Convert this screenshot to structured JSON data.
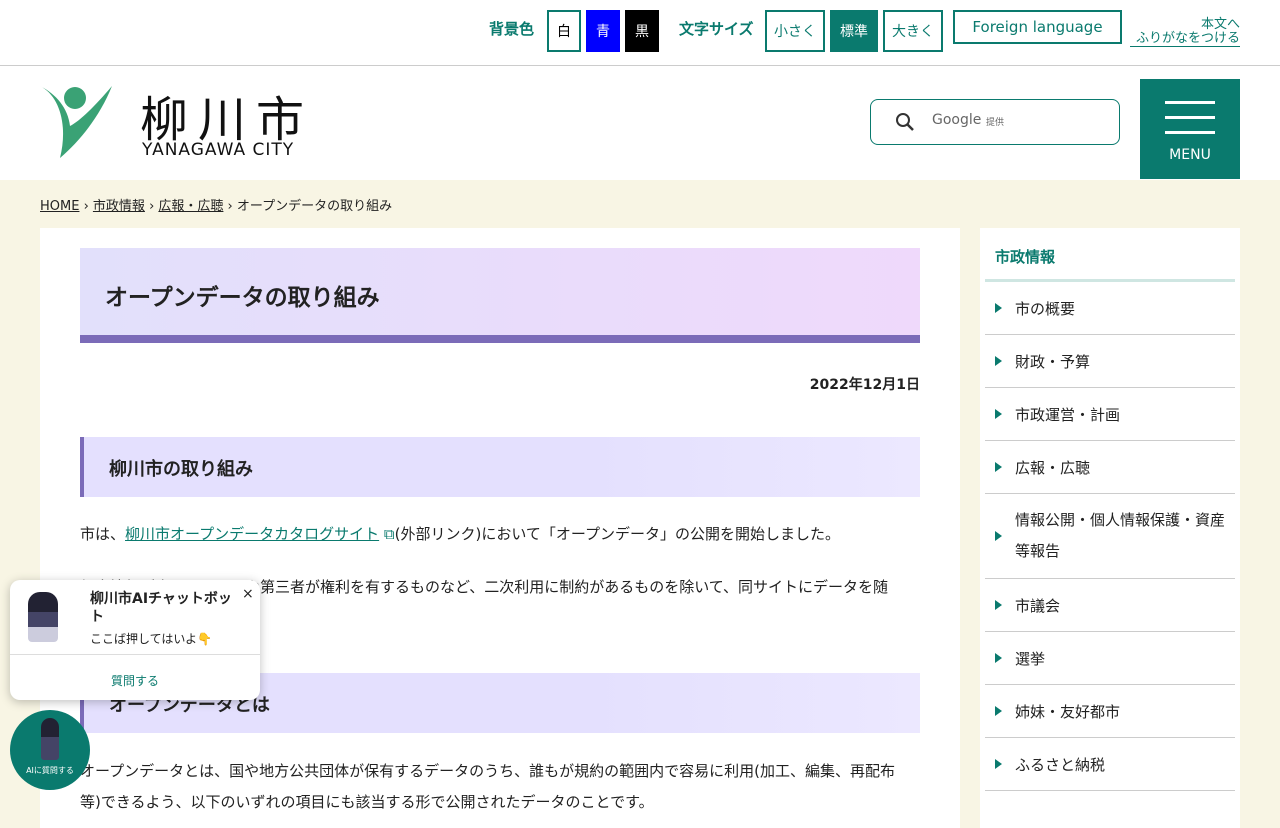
{
  "topbar": {
    "bg_label": "背景色",
    "bg_white": "白",
    "bg_blue": "青",
    "bg_black": "黒",
    "size_label": "文字サイズ",
    "size_small": "小さく",
    "size_normal": "標準",
    "size_large": "大きく",
    "foreign": "Foreign language",
    "furigana_1": "本文へ",
    "furigana_2": "ふりがなをつける"
  },
  "header": {
    "logo_jp": "柳川市",
    "logo_en": "YANAGAWA CITY",
    "search_brand": "Google",
    "search_provided": "提供",
    "menu": "MENU"
  },
  "breadcrumb": [
    "HOME",
    "市政情報",
    "広報・広聴",
    "オープンデータの取り組み"
  ],
  "main": {
    "title": "オープンデータの取り組み",
    "date": "2022年12月1日",
    "h2_1": "柳川市の取り組み",
    "p1_pre": "市は、",
    "p1_link": "柳川市オープンデータカタログサイト",
    "p1_post": "(外部リンク)において「オープンデータ」の公開を開始しました。",
    "p2": "個人情報が含まれるものや第三者が権利を有するものなど、二次利用に制約があるものを除いて、同サイトにデータを随",
    "h2_2": "オープンデータとは",
    "p3": "オープンデータとは、国や地方公共団体が保有するデータのうち、誰もが規約の範囲内で容易に利用(加工、編集、再配布",
    "p4": "等)できるよう、以下のいずれの項目にも該当する形で公開されたデータのことです。"
  },
  "sidebar": {
    "heading": "市政情報",
    "items": [
      "市の概要",
      "財政・予算",
      "市政運営・計画",
      "広報・広聴",
      "情報公開・個人情報保護・資産等報告",
      "市議会",
      "選挙",
      "姉妹・友好都市",
      "ふるさと納税"
    ]
  },
  "chat": {
    "title": "柳川市AIチャットボット",
    "message": "ここば押してはいよ👇",
    "ask": "質問する",
    "close": "×",
    "fab_label": "AIに質問する"
  }
}
